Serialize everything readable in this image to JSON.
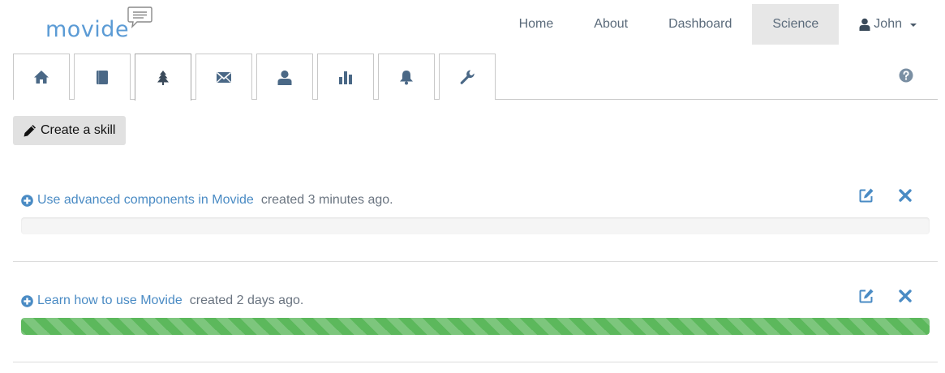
{
  "brand": {
    "name": "movide"
  },
  "nav": {
    "links": [
      {
        "label": "Home"
      },
      {
        "label": "About"
      },
      {
        "label": "Dashboard"
      },
      {
        "label": "Science"
      }
    ],
    "active": "Science",
    "user": "John"
  },
  "tabs": [
    {
      "icon": "home-icon"
    },
    {
      "icon": "book-icon"
    },
    {
      "icon": "tree-icon",
      "active": true
    },
    {
      "icon": "envelope-icon"
    },
    {
      "icon": "user-icon"
    },
    {
      "icon": "bar-chart-icon"
    },
    {
      "icon": "bell-icon"
    },
    {
      "icon": "wrench-icon"
    }
  ],
  "help_icon": "question-circle-icon",
  "toolbar": {
    "create_label": "Create a skill"
  },
  "skills": [
    {
      "title": "Use advanced components in Movide",
      "meta": "created 3 minutes ago.",
      "progress": 0
    },
    {
      "title": "Learn how to use Movide",
      "meta": "created 2 days ago.",
      "progress": 1.0
    }
  ],
  "colors": {
    "link": "#4a8bc4",
    "brand": "#5b9bd5",
    "progress": "#5cb85c",
    "active_nav_bg": "#e7e7e7",
    "icon": "#4a6886"
  }
}
